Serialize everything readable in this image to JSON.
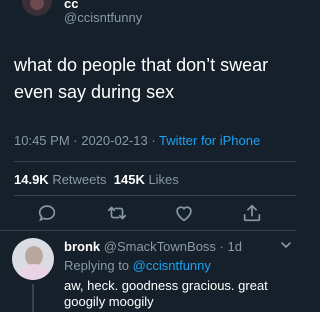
{
  "tweet": {
    "display_name": "cc",
    "handle": "@ccisntfunny",
    "text": "what do people that don’t swear even say during sex",
    "time": "10:45 PM",
    "separator": " · ",
    "date": "2020-02-13",
    "source": "Twitter for iPhone",
    "retweets_count": "14.9K",
    "retweets_label": " Retweets",
    "likes_count": "145K",
    "likes_label": " Likes"
  },
  "actions": [
    "reply-icon",
    "retweet-icon",
    "like-icon",
    "share-icon"
  ],
  "reply": {
    "display_name": "bronk",
    "handle": "@SmackTownBoss",
    "age": "1d",
    "separator": " · ",
    "replying_prefix": "Replying to ",
    "replying_to": "@ccisntfunny",
    "text": "aw, heck. goodness gracious. great googily moogily"
  },
  "colors": {
    "background": "#15202b",
    "secondary_text": "#8899a6",
    "accent": "#1da1f2",
    "divider": "#38444d"
  }
}
